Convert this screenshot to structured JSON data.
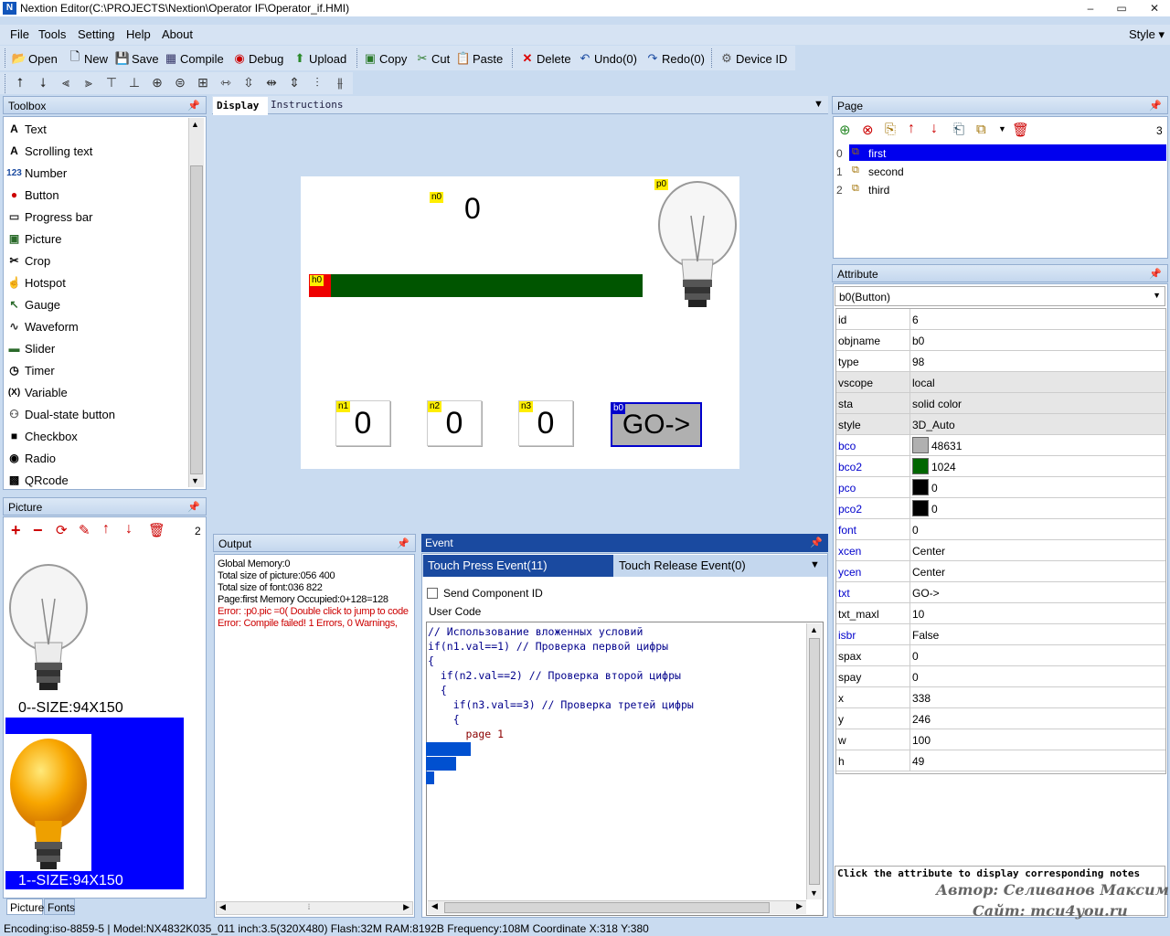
{
  "window": {
    "title": "Nextion Editor(C:\\PROJECTS\\Nextion\\Operator IF\\Operator_if.HMI)",
    "icon": "N",
    "minimize": "–",
    "maximize": "▭",
    "close": "✕"
  },
  "menu": {
    "items": [
      "File",
      "Tools",
      "Setting",
      "Help",
      "About"
    ],
    "style": "Style ▾"
  },
  "toolbar": {
    "open": "Open",
    "new": "New",
    "save": "Save",
    "compile": "Compile",
    "debug": "Debug",
    "upload": "Upload",
    "copy": "Copy",
    "cut": "Cut",
    "paste": "Paste",
    "delete": "Delete",
    "undo": "Undo(0)",
    "redo": "Redo(0)",
    "device_id": "Device  ID"
  },
  "toolbox": {
    "title": "Toolbox",
    "items": [
      {
        "label": "Text",
        "icon": "A"
      },
      {
        "label": "Scrolling text",
        "icon": "A"
      },
      {
        "label": "Number",
        "icon": "123"
      },
      {
        "label": "Button",
        "icon": "●"
      },
      {
        "label": "Progress bar",
        "icon": "▭"
      },
      {
        "label": "Picture",
        "icon": "▣"
      },
      {
        "label": "Crop",
        "icon": "✂"
      },
      {
        "label": "Hotspot",
        "icon": "☝"
      },
      {
        "label": "Gauge",
        "icon": "↖"
      },
      {
        "label": "Waveform",
        "icon": "∿"
      },
      {
        "label": "Slider",
        "icon": "▬"
      },
      {
        "label": "Timer",
        "icon": "◷"
      },
      {
        "label": "Variable",
        "icon": "(X)"
      },
      {
        "label": "Dual-state button",
        "icon": "⚇"
      },
      {
        "label": "Checkbox",
        "icon": "■"
      },
      {
        "label": "Radio",
        "icon": "◉"
      },
      {
        "label": "QRcode",
        "icon": "▩"
      }
    ]
  },
  "picture_panel": {
    "title": "Picture",
    "count": "2",
    "pic0_label": "0--SIZE:94X150",
    "pic1_label": "1--SIZE:94X150",
    "tabs": [
      "Picture",
      "Fonts"
    ]
  },
  "display": {
    "tabs": [
      "Display",
      "Instructions"
    ],
    "tags": {
      "n0": "n0",
      "p0": "p0",
      "h0": "h0",
      "n1": "n1",
      "n2": "n2",
      "n3": "n3",
      "b0": "b0"
    },
    "n0_value": "0",
    "n1_value": "0",
    "n2_value": "0",
    "n3_value": "0",
    "button_text": "GO->",
    "progress_value": 0
  },
  "output": {
    "title": "Output",
    "lines": [
      {
        "text": "Global Memory:0",
        "color": "#000000"
      },
      {
        "text": "Total size of picture:056 400",
        "color": "#000000"
      },
      {
        "text": "Total size of font:036 822",
        "color": "#000000"
      },
      {
        "text": "Page:first  Memory Occupied:0+128=128",
        "color": "#000000"
      },
      {
        "text": "Error: :p0.pic =0( Double click to jump to code",
        "color": "#cc0000"
      },
      {
        "text": "Error: Compile failed! 1 Errors, 0 Warnings,",
        "color": "#cc0000"
      }
    ]
  },
  "event": {
    "title": "Event",
    "tab_press": "Touch Press Event(11)",
    "tab_release": "Touch Release Event(0)",
    "send_component_id": "Send Component ID",
    "user_code_label": "User Code",
    "code_lines": [
      "// Использование вложенных условий",
      "if(n1.val==1) // Проверка первой цифры",
      "{",
      "  if(n2.val==2) // Проверка второй цифры",
      "  {",
      "    if(n3.val==3) // Проверка третей цифры",
      "    {",
      "      page 1",
      "    }",
      "  }",
      "}"
    ]
  },
  "page_panel": {
    "title": "Page",
    "count": "3",
    "pages": [
      {
        "index": "0",
        "name": "first"
      },
      {
        "index": "1",
        "name": "second"
      },
      {
        "index": "2",
        "name": "third"
      }
    ]
  },
  "attribute_panel": {
    "title": "Attribute",
    "selected": "b0(Button)",
    "rows": [
      {
        "name": "id",
        "value": "6",
        "name_color": "#000000",
        "shaded": false
      },
      {
        "name": "objname",
        "value": "b0",
        "name_color": "#000000",
        "shaded": false
      },
      {
        "name": "type",
        "value": "98",
        "name_color": "#000000",
        "shaded": false
      },
      {
        "name": "vscope",
        "value": "local",
        "name_color": "#000000",
        "shaded": true
      },
      {
        "name": "sta",
        "value": "solid color",
        "name_color": "#000000",
        "shaded": true
      },
      {
        "name": "style",
        "value": "3D_Auto",
        "name_color": "#000000",
        "shaded": true
      },
      {
        "name": "bco",
        "value": "48631",
        "name_color": "#0000cc",
        "shaded": false,
        "swatch": "#b0b0b0"
      },
      {
        "name": "bco2",
        "value": "1024",
        "name_color": "#0000cc",
        "shaded": false,
        "swatch": "#006600"
      },
      {
        "name": "pco",
        "value": "0",
        "name_color": "#0000cc",
        "shaded": false,
        "swatch": "#000000"
      },
      {
        "name": "pco2",
        "value": "0",
        "name_color": "#0000cc",
        "shaded": false,
        "swatch": "#000000"
      },
      {
        "name": "font",
        "value": "0",
        "name_color": "#0000cc",
        "shaded": false
      },
      {
        "name": "xcen",
        "value": "Center",
        "name_color": "#0000cc",
        "shaded": false
      },
      {
        "name": "ycen",
        "value": "Center",
        "name_color": "#0000cc",
        "shaded": false
      },
      {
        "name": "txt",
        "value": "GO->",
        "name_color": "#0000cc",
        "shaded": false
      },
      {
        "name": "txt_maxl",
        "value": "10",
        "name_color": "#000000",
        "shaded": false
      },
      {
        "name": "isbr",
        "value": "False",
        "name_color": "#0000cc",
        "shaded": false
      },
      {
        "name": "spax",
        "value": "0",
        "name_color": "#000000",
        "shaded": false
      },
      {
        "name": "spay",
        "value": "0",
        "name_color": "#000000",
        "shaded": false
      },
      {
        "name": "x",
        "value": "338",
        "name_color": "#000000",
        "shaded": false
      },
      {
        "name": "y",
        "value": "246",
        "name_color": "#000000",
        "shaded": false
      },
      {
        "name": "w",
        "value": "100",
        "name_color": "#000000",
        "shaded": false
      },
      {
        "name": "h",
        "value": "49",
        "name_color": "#000000",
        "shaded": false
      }
    ],
    "notes": "Click the attribute to display corresponding notes",
    "watermark_author": "Автор: Селиванов Максим",
    "watermark_site": "Сайт: mcu4you.ru"
  },
  "statusbar": {
    "text": "Encoding:iso-8859-5 | Model:NX4832K035_011  inch:3.5(320X480) Flash:32M RAM:8192B Frequency:108M    Coordinate X:318  Y:380"
  }
}
